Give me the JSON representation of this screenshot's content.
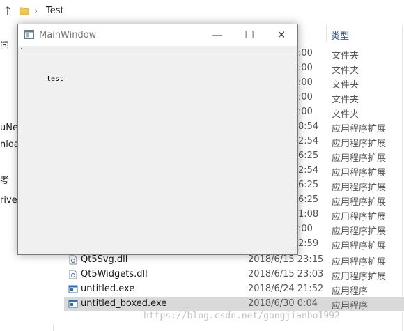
{
  "explorer": {
    "breadcrumb": "Test",
    "column_header_type": "类型",
    "sidebar_fragments": [
      "问",
      "uNet",
      "nload",
      "考",
      "rive"
    ],
    "hidden_rows": [
      {
        "time": ":00",
        "type": "文件夹"
      },
      {
        "time": ":00",
        "type": "文件夹"
      },
      {
        "time": ":00",
        "type": "文件夹"
      },
      {
        "time": ":00",
        "type": "文件夹"
      },
      {
        "time": ":00",
        "type": "文件夹"
      },
      {
        "time": "8:54",
        "type": "应用程序扩展"
      },
      {
        "time": "2:54",
        "type": "应用程序扩展"
      },
      {
        "time": "6:25",
        "type": "应用程序扩展"
      },
      {
        "time": "2:54",
        "type": "应用程序扩展"
      },
      {
        "time": "6:25",
        "type": "应用程序扩展"
      },
      {
        "time": "6:25",
        "type": "应用程序扩展"
      },
      {
        "time": "1:08",
        "type": "应用程序扩展"
      },
      {
        "time": ":00",
        "type": "应用程序扩展"
      },
      {
        "time": "2:59",
        "type": "应用程序扩展"
      }
    ],
    "files": [
      {
        "name": "Qt5Svg.dll",
        "date": "2018/6/15 23:15",
        "type": "应用程序扩展",
        "icon": "dll-icon",
        "selected": false
      },
      {
        "name": "Qt5Widgets.dll",
        "date": "2018/6/15 23:03",
        "type": "应用程序扩展",
        "icon": "dll-icon",
        "selected": false
      },
      {
        "name": "untitled.exe",
        "date": "2018/6/24 21:52",
        "type": "应用程序",
        "icon": "exe-icon",
        "selected": false
      },
      {
        "name": "untitled_boxed.exe",
        "date": "2018/6/30 0:04",
        "type": "应用程序",
        "icon": "exe-icon",
        "selected": true
      }
    ]
  },
  "qt_window": {
    "title": "MainWindow",
    "minimize_glyph": "—",
    "maximize_glyph": "☐",
    "close_glyph": "✕",
    "label_text": "test"
  },
  "watermark": "https://blog.csdn.net/gongjianbo1992",
  "colors": {
    "selection": "#d9d9d9",
    "window_bg": "#f0f0f0",
    "header_text": "#3a5f8a"
  }
}
